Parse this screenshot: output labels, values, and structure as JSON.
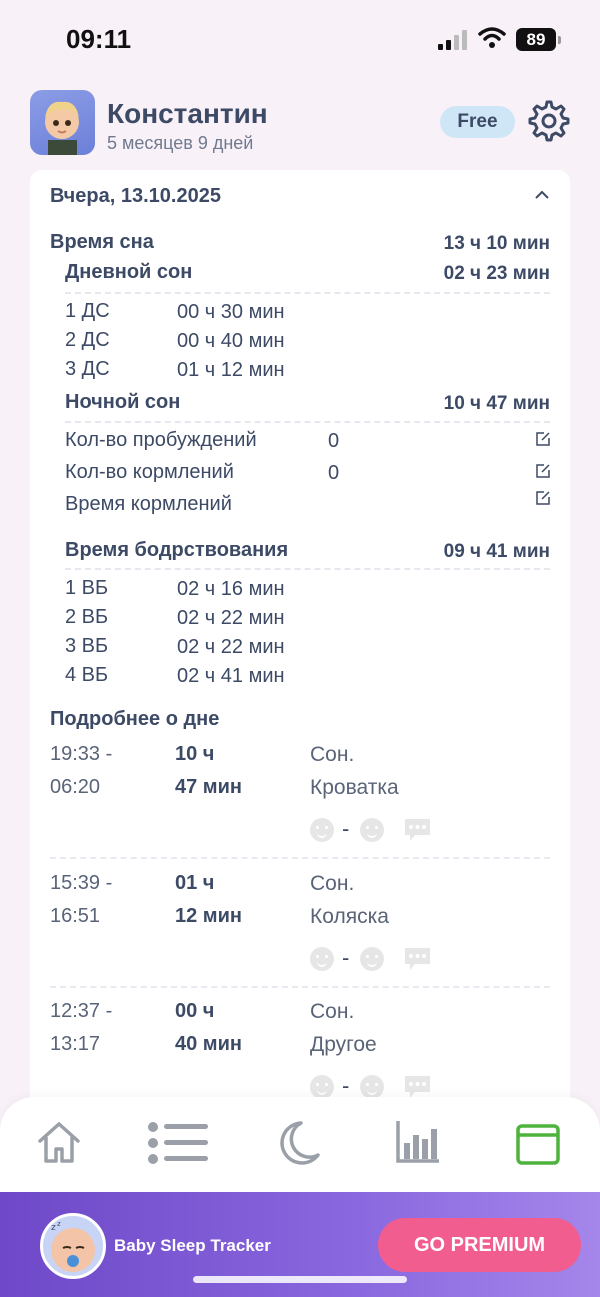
{
  "status_bar": {
    "time": "09:11",
    "battery": "89"
  },
  "header": {
    "child_name": "Константин",
    "child_age": "5 месяцев 9 дней",
    "plan_badge": "Free"
  },
  "day": {
    "date_title": "Вчера, 13.10.2025",
    "sleep_total": {
      "label": "Время сна",
      "value": "13 ч 10 мин"
    },
    "day_sleep": {
      "label": "Дневной сон",
      "value": "02 ч 23 мин"
    },
    "day_naps": [
      {
        "label": "1 ДС",
        "value": "00 ч 30 мин"
      },
      {
        "label": "2 ДС",
        "value": "00 ч 40 мин"
      },
      {
        "label": "3 ДС",
        "value": "01 ч 12 мин"
      }
    ],
    "night_sleep": {
      "label": "Ночной сон",
      "value": "10 ч 47 мин"
    },
    "night_stats": [
      {
        "label": "Кол-во пробуждений",
        "value": "0"
      },
      {
        "label": "Кол-во кормлений",
        "value": "0"
      },
      {
        "label": "Время кормлений",
        "value": ""
      }
    ],
    "awake": {
      "label": "Время бодрствования",
      "value": "09 ч 41 мин"
    },
    "wake_windows": [
      {
        "label": "1 ВБ",
        "value": "02 ч 16 мин"
      },
      {
        "label": "2 ВБ",
        "value": "02 ч 22 мин"
      },
      {
        "label": "3 ВБ",
        "value": "02 ч 22 мин"
      },
      {
        "label": "4 ВБ",
        "value": "02 ч 41 мин"
      }
    ],
    "details_title": "Подробнее о дне",
    "entries": [
      {
        "start": "19:33 -",
        "end": "06:20",
        "hours": "10 ч",
        "minutes": "47 мин",
        "type": "Сон.",
        "place": "Кроватка"
      },
      {
        "start": "15:39 -",
        "end": "16:51",
        "hours": "01 ч",
        "minutes": "12 мин",
        "type": "Сон.",
        "place": "Коляска"
      },
      {
        "start": "12:37 -",
        "end": "13:17",
        "hours": "00 ч",
        "minutes": "40 мин",
        "type": "Сон.",
        "place": "Другое"
      }
    ],
    "mood_separator": "-"
  },
  "tabs": [
    {
      "name": "home-icon"
    },
    {
      "name": "list-icon"
    },
    {
      "name": "moon-icon"
    },
    {
      "name": "bar-chart-icon"
    },
    {
      "name": "calendar-icon",
      "active": true
    }
  ],
  "promo": {
    "title": "Baby Sleep Tracker",
    "button": "GO PREMIUM"
  },
  "colors": {
    "accent": "#4db33d",
    "primary_text": "#3d4a66",
    "premium_button": "#f05d8e",
    "promo_bg": "#7a55d4"
  }
}
